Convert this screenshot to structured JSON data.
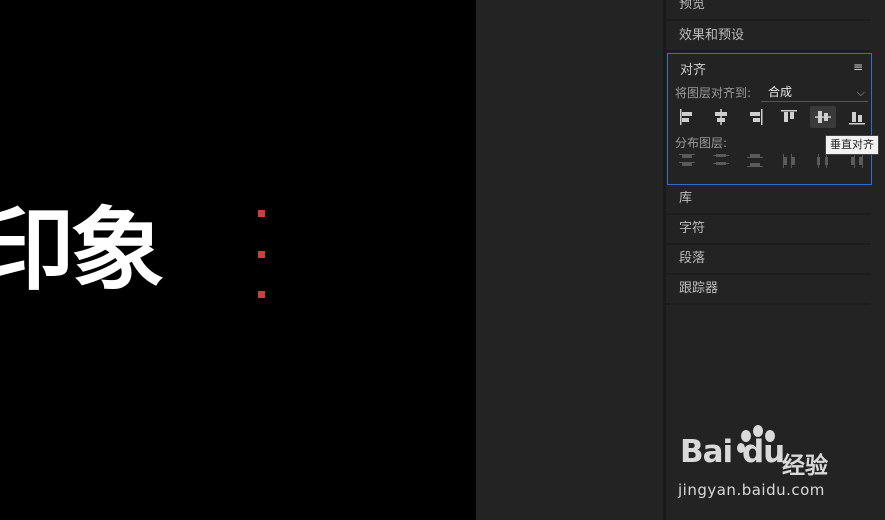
{
  "canvas": {
    "text": "印象"
  },
  "panel": {
    "sections_top": [
      "预览",
      "效果和预设"
    ],
    "align": {
      "title": "对齐",
      "menu_icon": "hamburger-menu-icon",
      "align_to_label": "将图层对齐到:",
      "align_to_value": "合成",
      "distribute_label": "分布图层:",
      "align_buttons": [
        "align-left",
        "align-horizontal-center",
        "align-right",
        "align-top",
        "align-vertical-center",
        "align-bottom"
      ],
      "distribute_buttons": [
        "distribute-top",
        "distribute-vertical-center",
        "distribute-bottom",
        "distribute-left",
        "distribute-horizontal-center",
        "distribute-right"
      ],
      "tooltip": "垂直对齐"
    },
    "sections_bottom": [
      "库",
      "字符",
      "段落",
      "跟踪器"
    ]
  },
  "watermark": {
    "logo": "Bai du",
    "cn": "经验",
    "url": "jingyan.baidu.com"
  },
  "colors": {
    "panel_bg": "#232323",
    "focus_border": "#2f6fc4",
    "selection_handle": "#d23c3c"
  }
}
